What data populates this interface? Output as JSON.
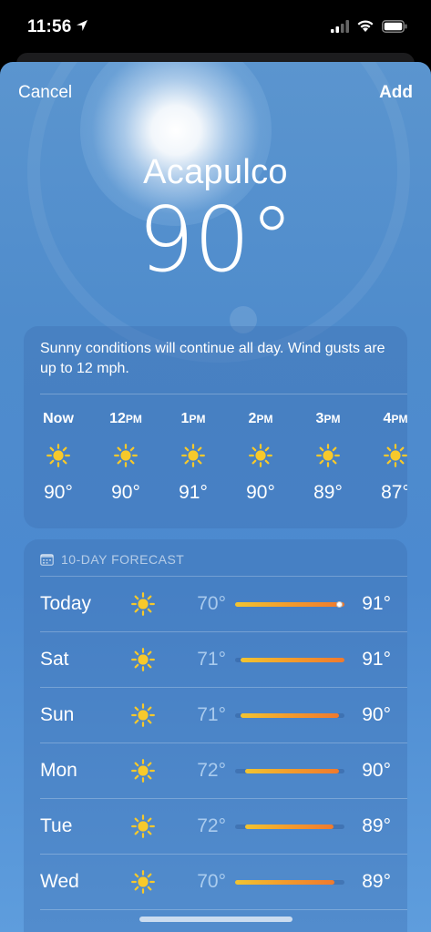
{
  "status_bar": {
    "time": "11:56"
  },
  "nav": {
    "cancel": "Cancel",
    "add": "Add"
  },
  "city": "Acapulco",
  "current_temp": "90°",
  "summary": "Sunny conditions will continue all day. Wind gusts are up to 12 mph.",
  "hourly": [
    {
      "label": "Now",
      "suffix": "",
      "icon": "sun-icon",
      "temp": "90°"
    },
    {
      "label": "12",
      "suffix": "PM",
      "icon": "sun-icon",
      "temp": "90°"
    },
    {
      "label": "1",
      "suffix": "PM",
      "icon": "sun-icon",
      "temp": "91°"
    },
    {
      "label": "2",
      "suffix": "PM",
      "icon": "sun-icon",
      "temp": "90°"
    },
    {
      "label": "3",
      "suffix": "PM",
      "icon": "sun-icon",
      "temp": "89°"
    },
    {
      "label": "4",
      "suffix": "PM",
      "icon": "sun-icon",
      "temp": "87°"
    }
  ],
  "forecast": {
    "header": "10-DAY FORECAST",
    "range_min": 70,
    "range_max": 91,
    "days": [
      {
        "day": "Today",
        "icon": "sun-icon",
        "low": "70°",
        "high": "91°",
        "low_value": 70,
        "high_value": 91,
        "current_value": 90
      },
      {
        "day": "Sat",
        "icon": "sun-icon",
        "low": "71°",
        "high": "91°",
        "low_value": 71,
        "high_value": 91
      },
      {
        "day": "Sun",
        "icon": "sun-icon",
        "low": "71°",
        "high": "90°",
        "low_value": 71,
        "high_value": 90
      },
      {
        "day": "Mon",
        "icon": "sun-icon",
        "low": "72°",
        "high": "90°",
        "low_value": 72,
        "high_value": 90
      },
      {
        "day": "Tue",
        "icon": "sun-icon",
        "low": "72°",
        "high": "89°",
        "low_value": 72,
        "high_value": 89
      },
      {
        "day": "Wed",
        "icon": "sun-icon",
        "low": "70°",
        "high": "89°",
        "low_value": 70,
        "high_value": 89
      }
    ]
  },
  "colors": {
    "sun": "#f7c92b",
    "bar_start": "#f2c431",
    "bar_end": "#ef7a2e"
  }
}
